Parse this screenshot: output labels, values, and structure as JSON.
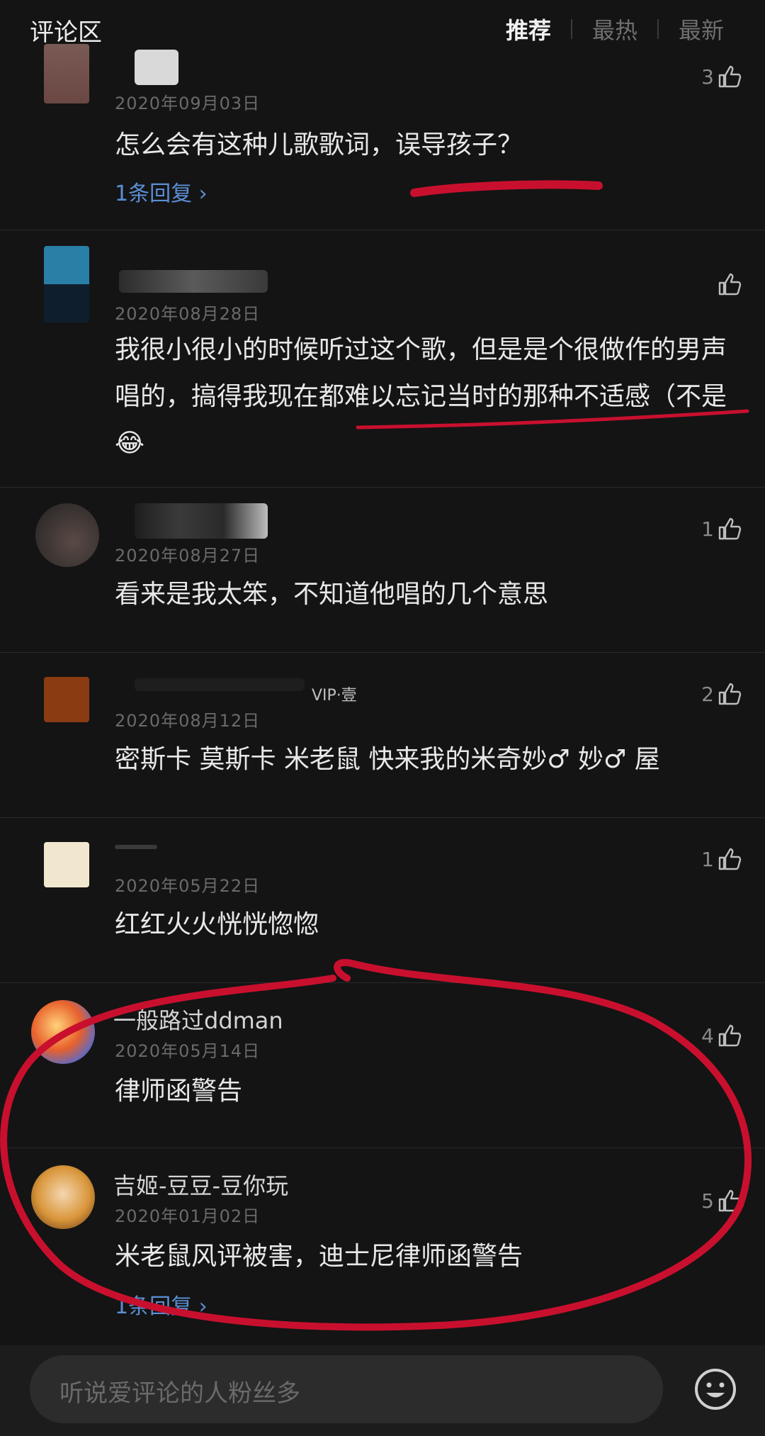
{
  "header": {
    "title": "评论区",
    "tabs": [
      {
        "label": "推荐",
        "active": true
      },
      {
        "label": "最热",
        "active": false
      },
      {
        "label": "最新",
        "active": false
      }
    ]
  },
  "comments": [
    {
      "username": "",
      "date": "2020年09月03日",
      "likes": "3",
      "text": "怎么会有这种儿歌歌词，误导孩子？",
      "reply": "1条回复"
    },
    {
      "username": "",
      "date": "2020年08月28日",
      "likes": "",
      "text": "我很小很小的时候听过这个歌，但是是个很做作的男声唱的，搞得我现在都难以忘记当时的那种不适感（不是😂"
    },
    {
      "username": "",
      "date": "2020年08月27日",
      "likes": "1",
      "text": "看来是我太笨，不知道他唱的几个意思"
    },
    {
      "username": "",
      "badge": "VIP·壹",
      "date": "2020年08月12日",
      "likes": "2",
      "text": "密斯卡 莫斯卡 米老鼠 快来我的米奇妙♂ 妙♂ 屋"
    },
    {
      "username": "",
      "date": "2020年05月22日",
      "likes": "1",
      "text": "红红火火恍恍惚惚"
    },
    {
      "username": "一般路过ddman",
      "date": "2020年05月14日",
      "likes": "4",
      "text": "律师函警告"
    },
    {
      "username": "吉姬-豆豆-豆你玩",
      "date": "2020年01月02日",
      "likes": "5",
      "text": "米老鼠风评被害，迪士尼律师函警告",
      "reply": "1条回复"
    }
  ],
  "input": {
    "placeholder": "听说爱评论的人粉丝多"
  },
  "colors": {
    "background": "#141414",
    "reply_link": "#5b8fd6",
    "annotation": "#c8102e"
  }
}
